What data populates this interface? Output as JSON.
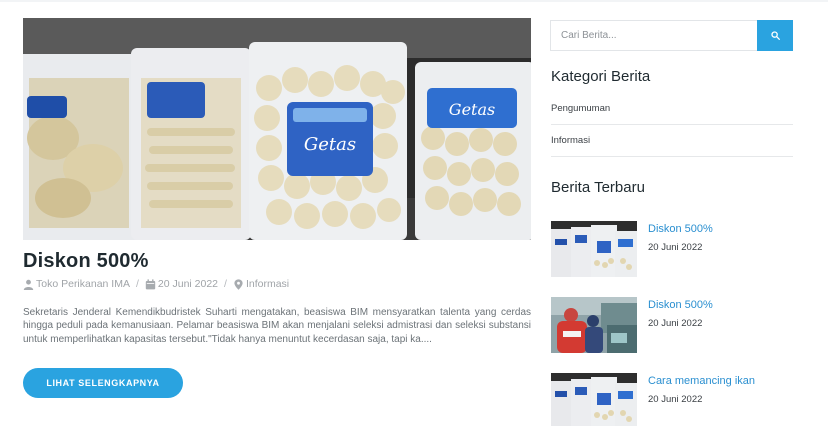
{
  "article": {
    "image_alt": "Produk getas dalam kemasan plastik",
    "title": "Diskon 500%",
    "meta": {
      "author": "Toko Perikanan IMA",
      "date": "20 Juni 2022",
      "category": "Informasi",
      "separator": "/"
    },
    "excerpt": "Sekretaris Jenderal Kemendikbudristek Suharti mengatakan, beasiswa BIM mensyaratkan talenta yang cerdas hingga peduli pada kemanusiaan. Pelamar beasiswa BIM akan menjalani seleksi admistrasi dan seleksi substansi untuk memperlihatkan kapasitas tersebut.\"Tidak hanya menuntut kecerdasan saja, tapi ka....",
    "read_more": "LIHAT SELENGKAPNYA",
    "package_labels": [
      "Getas",
      "Getas"
    ]
  },
  "sidebar": {
    "search": {
      "placeholder": "Cari Berita..."
    },
    "categories": {
      "title": "Kategori Berita",
      "items": [
        "Pengumuman",
        "Informasi"
      ]
    },
    "recent": {
      "title": "Berita Terbaru",
      "items": [
        {
          "title": "Diskon 500%",
          "date": "20 Juni 2022"
        },
        {
          "title": "Diskon 500%",
          "date": "20 Juni 2022"
        },
        {
          "title": "Cara memancing ikan",
          "date": "20 Juni 2022"
        }
      ]
    }
  },
  "colors": {
    "accent": "#2aa3e0",
    "link": "#2a8fd0",
    "title": "#1f2a30",
    "muted": "#a0a4a8"
  },
  "icons": {
    "author": "user-icon",
    "date": "calendar-icon",
    "category": "map-pin-icon",
    "search": "search-icon"
  }
}
